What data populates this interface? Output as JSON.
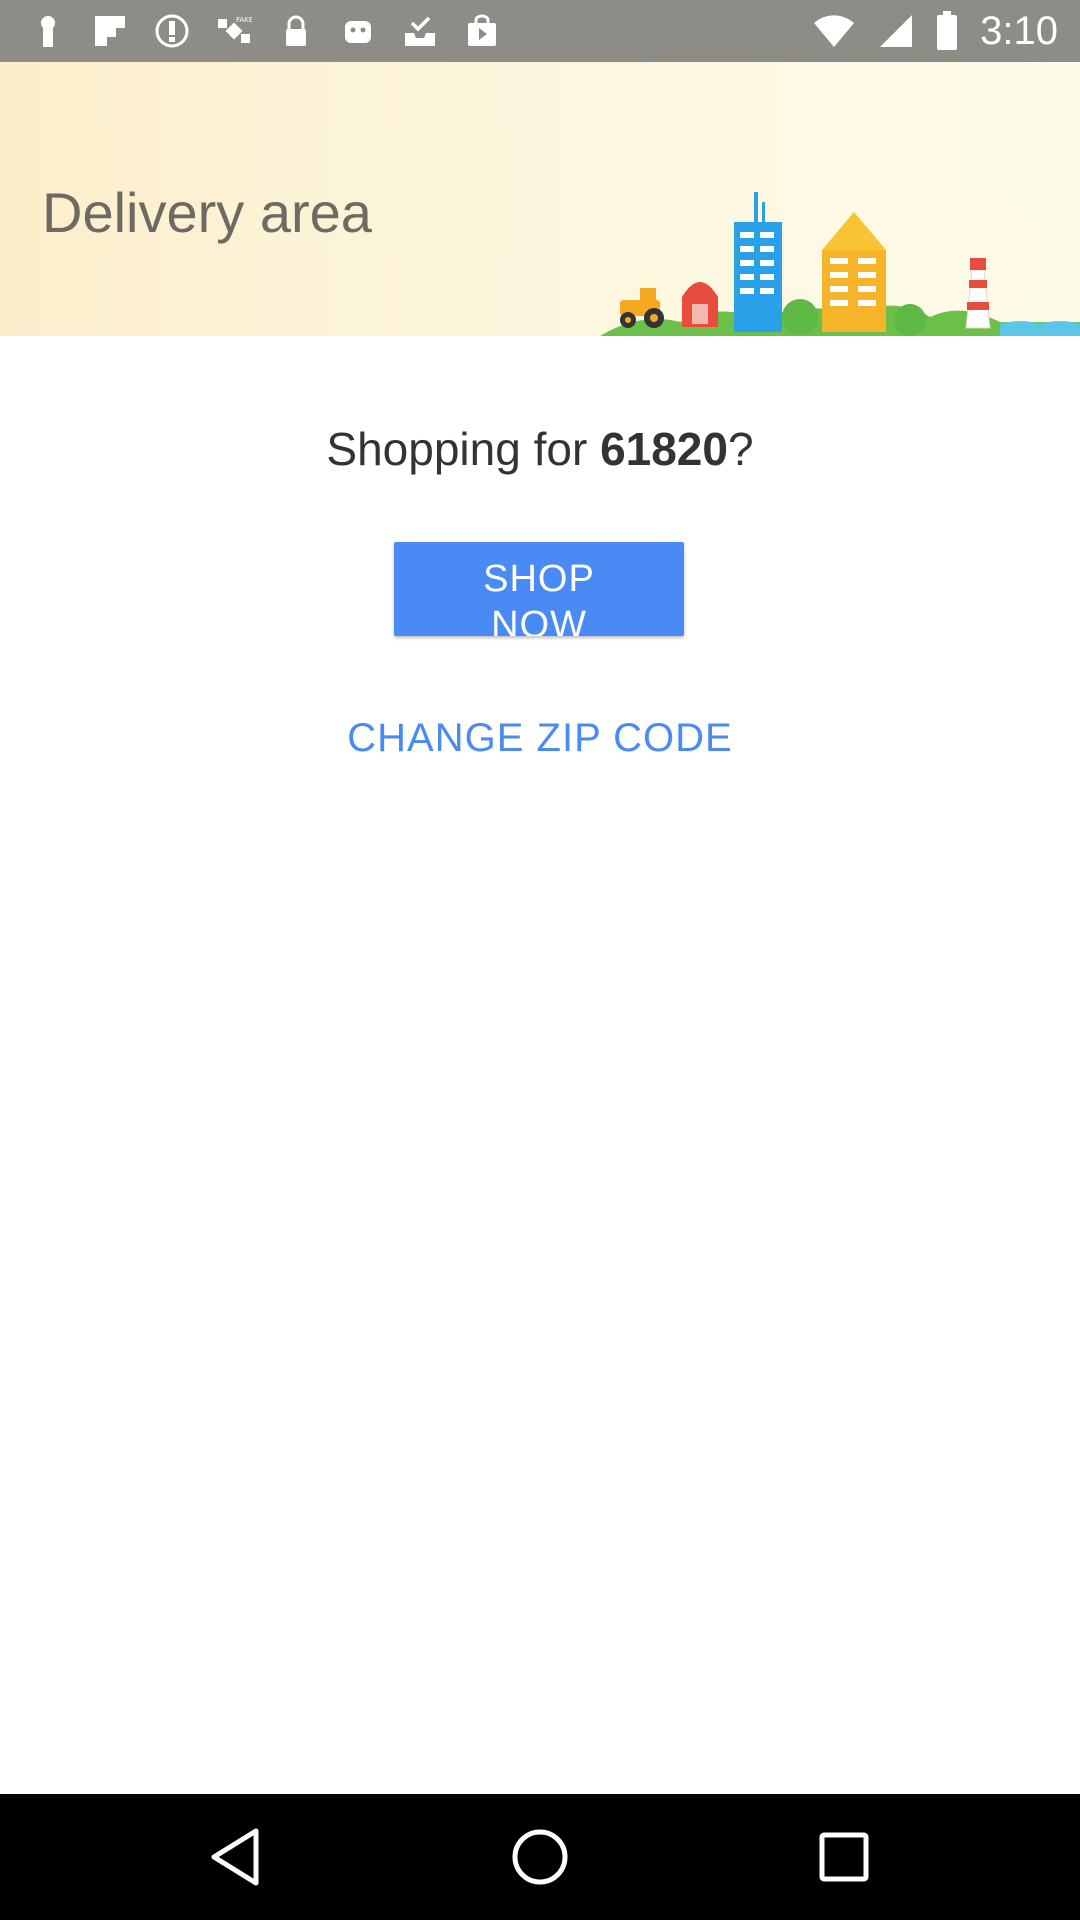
{
  "status_bar": {
    "time": "3:10",
    "left_icons": [
      "keyhole-icon",
      "flipboard-icon",
      "info-circle-icon",
      "fake-gps-satellite-icon",
      "lock-icon",
      "android-robot-icon",
      "inbox-check-icon",
      "play-bag-icon"
    ],
    "right_icons": [
      "wifi-icon",
      "cell-signal-icon",
      "battery-icon"
    ]
  },
  "header": {
    "title": "Delivery area"
  },
  "main": {
    "shopping_prefix": "Shopping for ",
    "zip_code": "61820",
    "shopping_suffix": "?",
    "shop_now_label": "SHOP NOW",
    "change_zip_label": "CHANGE ZIP CODE"
  },
  "nav_bar": {
    "buttons": [
      "back-icon",
      "home-icon",
      "recents-icon"
    ]
  },
  "colors": {
    "accent": "#4a8af4",
    "status_bar": "#8e8c86",
    "banner_bg": "#fdf3d6"
  }
}
